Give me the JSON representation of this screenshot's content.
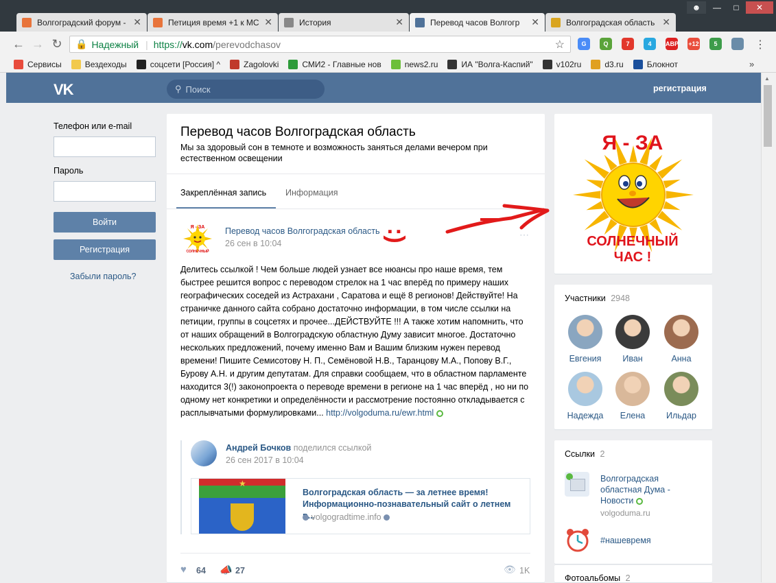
{
  "browser": {
    "tabs": [
      {
        "title": "Волгоградский форум -",
        "color": "#e8743b"
      },
      {
        "title": "Петиция время +1 к МС",
        "color": "#e8743b"
      },
      {
        "title": "История",
        "color": "#888888"
      },
      {
        "title": "Перевод часов Волгогр",
        "color": "#507299"
      },
      {
        "title": "Волгоградская область",
        "color": "#d9a520"
      }
    ],
    "address": {
      "secure_label": "Надежный",
      "protocol": "https://",
      "domain": "vk.com",
      "path": "/perevodchasov"
    },
    "extensions": [
      {
        "label": "G",
        "color": "#4a8cf7"
      },
      {
        "label": "Q",
        "color": "#5aa33a"
      },
      {
        "label": "7",
        "color": "#e2382c"
      },
      {
        "label": "4",
        "color": "#29a8e0"
      },
      {
        "label": "ABP",
        "color": "#d22"
      },
      {
        "label": "+12",
        "color": "#e94e3c"
      },
      {
        "label": "5",
        "color": "#3d9c4a"
      },
      {
        "label": "",
        "color": "#6a8ca8"
      }
    ],
    "bookmarks": [
      {
        "label": "Сервисы",
        "icon": "apps-icon",
        "color": "#e84c3d"
      },
      {
        "label": "Вездеходы",
        "icon": "folder-icon",
        "color": "#f2c94c"
      },
      {
        "label": "соцсети [Россия] ^",
        "icon": "m-icon",
        "color": "#222222"
      },
      {
        "label": "Zagolovki",
        "icon": "code-icon",
        "color": "#c0392b"
      },
      {
        "label": "СМИ2 - Главные нов",
        "icon": "smi2-icon",
        "color": "#2d9b3a"
      },
      {
        "label": "news2.ru",
        "icon": "news2-icon",
        "color": "#6cbf3a"
      },
      {
        "label": "ИА \"Волга-Каспий\"",
        "icon": "vk-icon",
        "color": "#333333"
      },
      {
        "label": "v102ru",
        "icon": "v102-icon",
        "color": "#333333"
      },
      {
        "label": "d3.ru",
        "icon": "d3-icon",
        "color": "#e0a020"
      },
      {
        "label": "Блокнот",
        "icon": "b-icon",
        "color": "#1a4f9c"
      }
    ],
    "bookmarks_more": "»"
  },
  "vk": {
    "search_placeholder": "Поиск",
    "register_link": "регистрация",
    "logo": "VK"
  },
  "login": {
    "phone_label": "Телефон или e-mail",
    "password_label": "Пароль",
    "login_button": "Войти",
    "register_button": "Регистрация",
    "forgot_link": "Забыли пароль?"
  },
  "group": {
    "title": "Перевод часов Волгоградская область",
    "description": "Мы за здоровый сон в темноте и возможность заняться делами вечером при естественном освещении",
    "tabs": [
      {
        "label": "Закреплённая запись",
        "active": true
      },
      {
        "label": "Информация",
        "active": false
      }
    ]
  },
  "post": {
    "author": "Перевод часов Волгоградская область",
    "date": "26 сен в 10:04",
    "text": "Делитесь ссылкой ! Чем больше людей узнает все нюансы про наше время, тем быстрее решится вопрос с переводом стрелок на 1 час вперёд по примеру наших географических соседей из Астрахани , Саратова и ещё 8 регионов! Действуйте! На страничке данного сайта собрано достаточно информации, в том числе ссылки на петиции, группы в соцсетях и прочее...ДЕЙСТВУЙТЕ !!! А также хотим напомнить, что от наших обращений в Волгоградскую областную Думу зависит многое. Достаточно нескольких предложений, почему именно Вам и Вашим близким нужен перевод времени! Пишите Семисотову Н. П., Семёновой Н.В., Таранцову М.А., Попову В.Г., Бурову А.Н. и другим депутатам. Для справки сообщаем, что в областном парламенте находится 3(!) законопроекта о переводе времени в регионе на 1 час вперёд , но ни по одному нет конкретики и определённости и рассмотрение постоянно откладывается с расплывчатыми формулировками...",
    "text_link": "http://volgoduma.ru/ewr.html",
    "repost": {
      "author": "Андрей Бочков",
      "action": "поделился ссылкой",
      "date": "26 сен 2017 в 10:04"
    },
    "snippet": {
      "title": "Волгоградская область — за летнее время! Информационно-познавательный сайт о летнем в...",
      "domain": "volgogradtime.info"
    },
    "likes": "64",
    "shares": "27",
    "views": "1K"
  },
  "annotation": {
    "smiley": ":)"
  },
  "cover": {
    "line1": "Я - ЗА",
    "line2": "СОЛНЕЧНЫЙ",
    "line3": "ЧАС !"
  },
  "members": {
    "title": "Участники",
    "count": "2948",
    "items": [
      {
        "name": "Евгения",
        "color": "#8aa6c0"
      },
      {
        "name": "Иван",
        "color": "#3b3b3b"
      },
      {
        "name": "Анна",
        "color": "#9c6b4f"
      },
      {
        "name": "Надежда",
        "color": "#a9c8e0"
      },
      {
        "name": "Елена",
        "color": "#d9b89a"
      },
      {
        "name": "Ильдар",
        "color": "#7a8c5a"
      }
    ]
  },
  "links": {
    "title": "Ссылки",
    "count": "2",
    "items": [
      {
        "title": "Волгоградская областная Дума - Новости",
        "domain": "volgoduma.ru"
      },
      {
        "title": "#нашевремя",
        "domain": ""
      }
    ]
  },
  "albums": {
    "title": "Фотоальбомы",
    "count": "2"
  }
}
